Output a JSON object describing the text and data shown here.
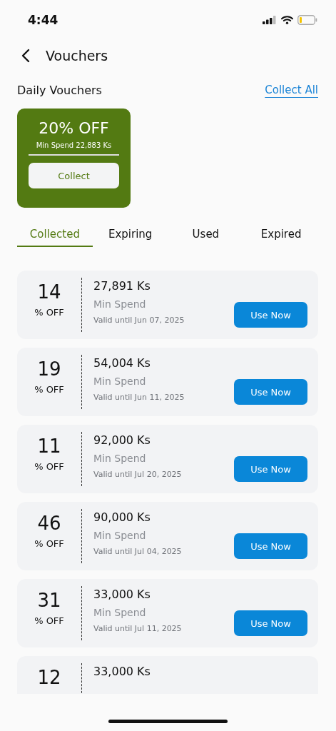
{
  "status_bar": {
    "time": "4:44"
  },
  "header": {
    "title": "Vouchers"
  },
  "daily": {
    "title": "Daily Vouchers",
    "collect_all": "Collect All",
    "vouchers": [
      {
        "discount": "20% OFF",
        "min_spend": "Min Spend 22,883 Ks",
        "button": "Collect"
      }
    ]
  },
  "tabs": [
    {
      "label": "Collected",
      "selected": true
    },
    {
      "label": "Expiring",
      "selected": false
    },
    {
      "label": "Used",
      "selected": false
    },
    {
      "label": "Expired",
      "selected": false
    }
  ],
  "vouchers": [
    {
      "percent": "14",
      "percent_label": "% OFF",
      "amount": "27,891 Ks",
      "min_label": "Min Spend",
      "valid": "Valid until Jun 07, 2025",
      "button": "Use Now"
    },
    {
      "percent": "19",
      "percent_label": "% OFF",
      "amount": "54,004 Ks",
      "min_label": "Min Spend",
      "valid": "Valid until Jun 11, 2025",
      "button": "Use Now"
    },
    {
      "percent": "11",
      "percent_label": "% OFF",
      "amount": "92,000 Ks",
      "min_label": "Min Spend",
      "valid": "Valid until Jul 20, 2025",
      "button": "Use Now"
    },
    {
      "percent": "46",
      "percent_label": "% OFF",
      "amount": "90,000 Ks",
      "min_label": "Min Spend",
      "valid": "Valid until Jul 04, 2025",
      "button": "Use Now"
    },
    {
      "percent": "31",
      "percent_label": "% OFF",
      "amount": "33,000 Ks",
      "min_label": "Min Spend",
      "valid": "Valid until Jul 11, 2025",
      "button": "Use Now"
    },
    {
      "percent": "12",
      "amount": "33,000 Ks"
    }
  ]
}
